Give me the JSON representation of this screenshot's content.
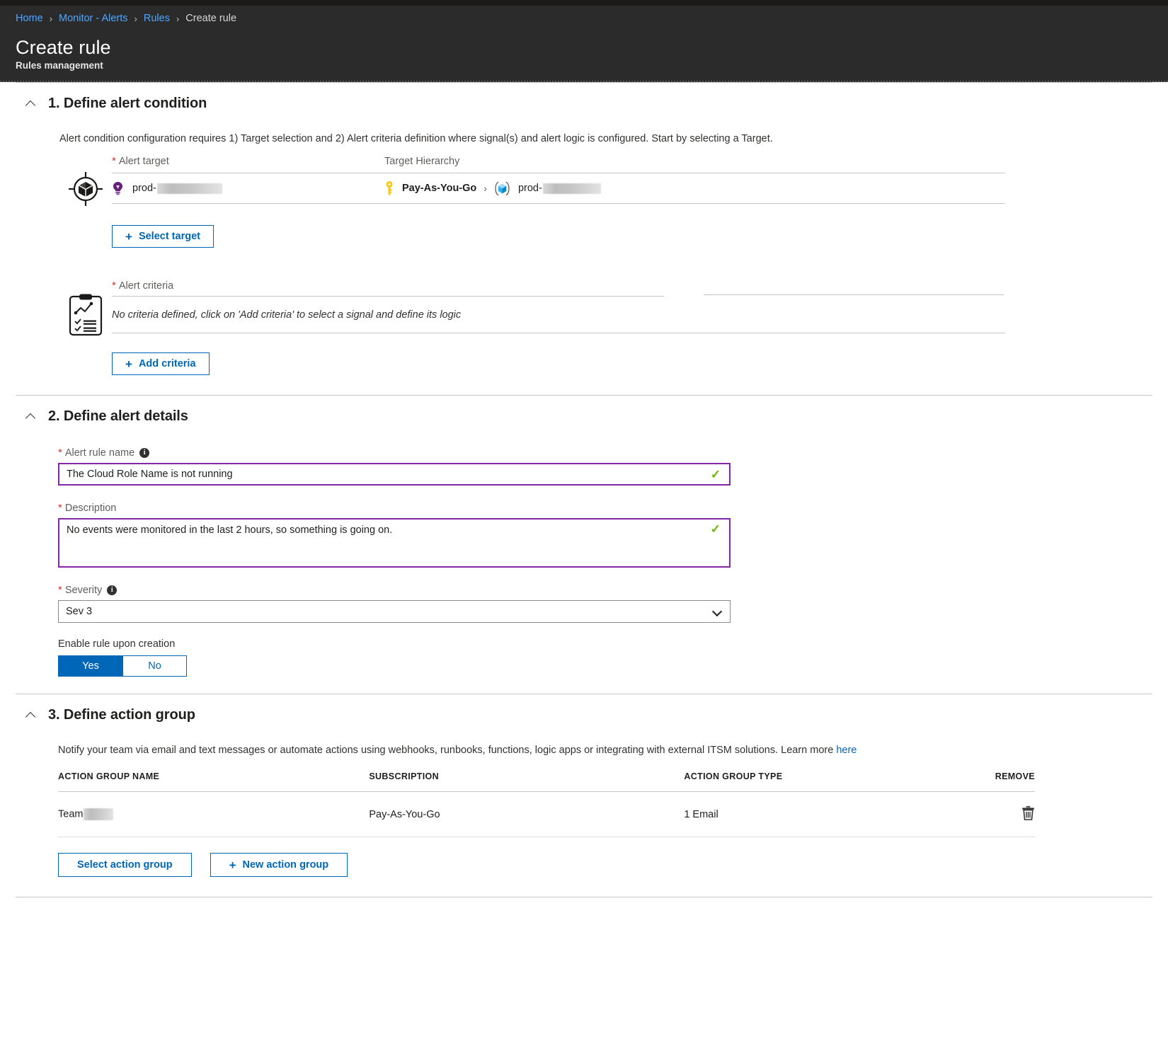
{
  "breadcrumb": {
    "items": [
      {
        "label": "Home",
        "current": false
      },
      {
        "label": "Monitor - Alerts",
        "current": false
      },
      {
        "label": "Rules",
        "current": false
      },
      {
        "label": "Create rule",
        "current": true
      }
    ],
    "separator": "›"
  },
  "header": {
    "title": "Create rule",
    "subtitle": "Rules management"
  },
  "section1": {
    "number_title": "1. Define alert condition",
    "help": "Alert condition configuration requires 1) Target selection and 2) Alert criteria definition where signal(s) and alert logic is configured. Start by selecting a Target.",
    "alert_target_label": "Alert target",
    "target_hierarchy_label": "Target Hierarchy",
    "target_value": "prod-",
    "hierarchy_subscription": "Pay-As-You-Go",
    "hierarchy_resource": "prod-",
    "select_target_button": "Select target",
    "alert_criteria_label": "Alert criteria",
    "criteria_empty_text": "No criteria defined, click on 'Add criteria' to select a signal and define its logic",
    "add_criteria_button": "Add criteria",
    "required_marker": "*"
  },
  "section2": {
    "number_title": "2. Define alert details",
    "rule_name_label": "Alert rule name",
    "rule_name_value": "The Cloud Role Name is not running",
    "description_label": "Description",
    "description_value": "No events were monitored in the last 2 hours, so something is going on.",
    "severity_label": "Severity",
    "severity_value": "Sev 3",
    "enable_label": "Enable rule upon creation",
    "enable_yes": "Yes",
    "enable_no": "No",
    "valid_check": "✓",
    "info_glyph": "i"
  },
  "section3": {
    "number_title": "3. Define action group",
    "notify_text": "Notify your team via email and text messages or automate actions using webhooks, runbooks, functions, logic apps or integrating with external ITSM solutions. Learn more ",
    "notify_link": "here",
    "columns": [
      "ACTION GROUP NAME",
      "SUBSCRIPTION",
      "ACTION GROUP TYPE",
      "REMOVE"
    ],
    "rows": [
      {
        "name": "Team",
        "subscription": "Pay-As-You-Go",
        "type": "1 Email"
      }
    ],
    "select_action_group_button": "Select action group",
    "new_action_group_button": "New action group"
  },
  "colors": {
    "link_blue": "#0067b8",
    "breadcrumb_blue": "#4ea6ff",
    "field_focus_purple": "#8327a8",
    "valid_green": "#6bb700",
    "required_red": "#d13438",
    "chrome_dark": "#2b2b2b"
  }
}
